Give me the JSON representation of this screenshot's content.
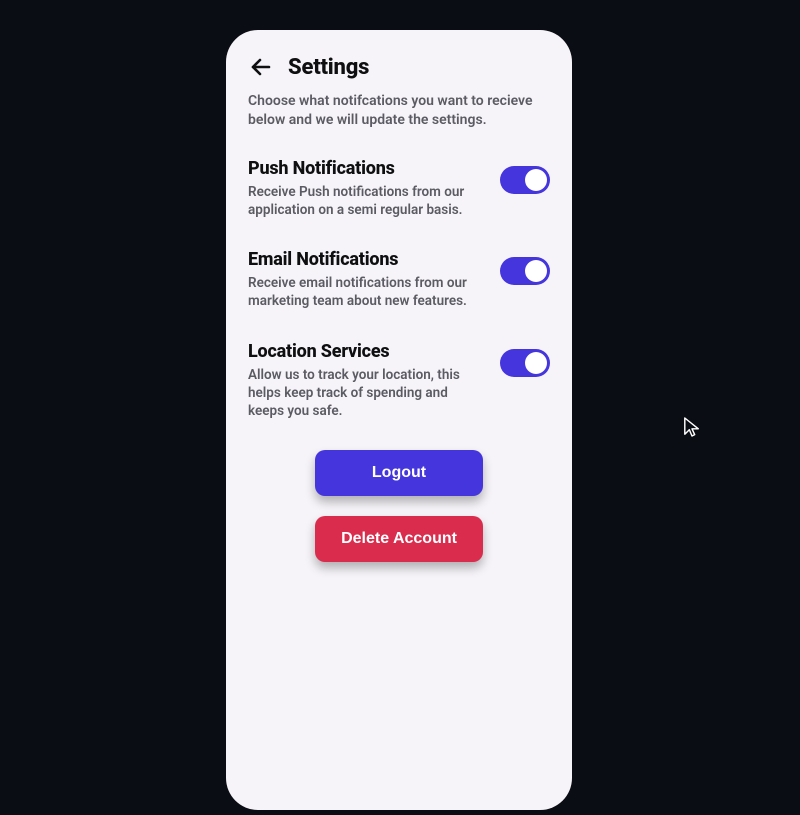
{
  "header": {
    "title": "Settings",
    "subtitle": "Choose what notifcations you want to recieve below and we will update the settings."
  },
  "settings": [
    {
      "key": "push",
      "title": "Push Notifications",
      "description": "Receive Push notifications from our application on a semi regular basis.",
      "enabled": true
    },
    {
      "key": "email",
      "title": "Email Notifications",
      "description": "Receive email notifications from our marketing team about new features.",
      "enabled": true
    },
    {
      "key": "location",
      "title": "Location Services",
      "description": "Allow us to track your location, this helps keep track of spending and keeps you safe.",
      "enabled": true
    }
  ],
  "actions": {
    "logout_label": "Logout",
    "delete_label": "Delete Account"
  },
  "colors": {
    "accent": "#4535dd",
    "danger": "#da2c4d",
    "surface": "#f6f4f8",
    "background": "#0a0d14",
    "text_primary": "#0f0f12",
    "text_secondary": "#5b5b63"
  }
}
